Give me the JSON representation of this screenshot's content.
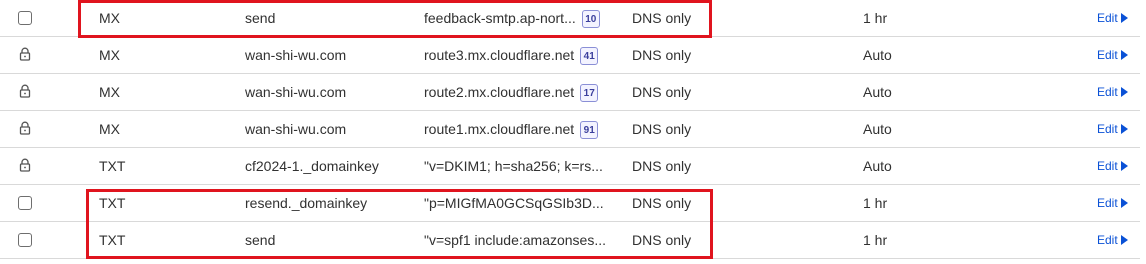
{
  "records": [
    {
      "locked": false,
      "type": "MX",
      "name": "send",
      "content": "feedback-smtp.ap-nort...",
      "priority": "10",
      "proxy": "DNS only",
      "ttl": "1 hr",
      "edit": "Edit"
    },
    {
      "locked": true,
      "type": "MX",
      "name": "wan-shi-wu.com",
      "content": "route3.mx.cloudflare.net",
      "priority": "41",
      "proxy": "DNS only",
      "ttl": "Auto",
      "edit": "Edit"
    },
    {
      "locked": true,
      "type": "MX",
      "name": "wan-shi-wu.com",
      "content": "route2.mx.cloudflare.net",
      "priority": "17",
      "proxy": "DNS only",
      "ttl": "Auto",
      "edit": "Edit"
    },
    {
      "locked": true,
      "type": "MX",
      "name": "wan-shi-wu.com",
      "content": "route1.mx.cloudflare.net",
      "priority": "91",
      "proxy": "DNS only",
      "ttl": "Auto",
      "edit": "Edit"
    },
    {
      "locked": true,
      "type": "TXT",
      "name": "cf2024-1._domainkey",
      "content": "\"v=DKIM1; h=sha256; k=rs...",
      "priority": "",
      "proxy": "DNS only",
      "ttl": "Auto",
      "edit": "Edit"
    },
    {
      "locked": false,
      "type": "TXT",
      "name": "resend._domainkey",
      "content": "\"p=MIGfMA0GCSqGSIb3D...",
      "priority": "",
      "proxy": "DNS only",
      "ttl": "1 hr",
      "edit": "Edit"
    },
    {
      "locked": false,
      "type": "TXT",
      "name": "send",
      "content": "\"v=spf1 include:amazonses...",
      "priority": "",
      "proxy": "DNS only",
      "ttl": "1 hr",
      "edit": "Edit"
    }
  ],
  "colors": {
    "highlight": "#e0141e",
    "link": "#0a51d6",
    "badge_border": "#8a8fd6"
  }
}
